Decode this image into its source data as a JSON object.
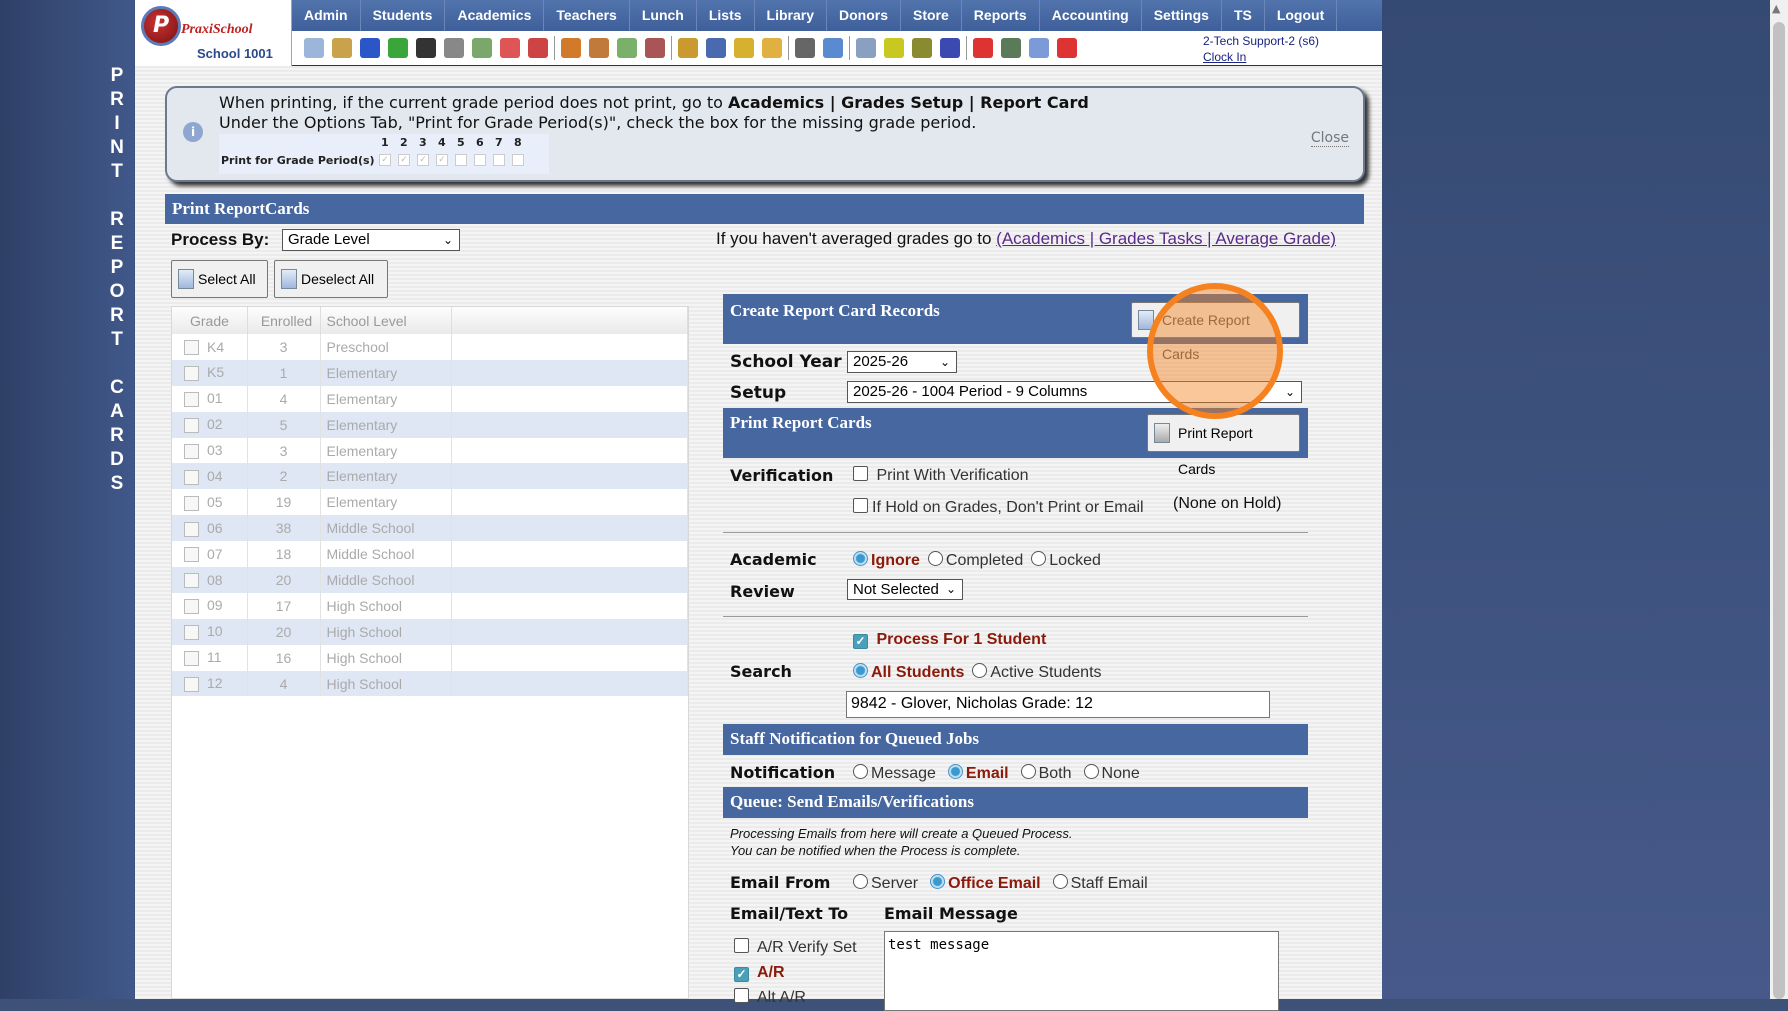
{
  "side_title": [
    "P",
    "R",
    "I",
    "N",
    "T",
    "",
    "R",
    "E",
    "P",
    "O",
    "R",
    "T",
    "",
    "C",
    "A",
    "R",
    "D",
    "S"
  ],
  "logo": {
    "brand": "PraxiSchool",
    "school": "School 1001"
  },
  "nav": [
    "Admin",
    "Students",
    "Academics",
    "Teachers",
    "Lunch",
    "Lists",
    "Library",
    "Donors",
    "Store",
    "Reports",
    "Accounting",
    "Settings",
    "TS",
    "Logout"
  ],
  "toolbar_icons": [
    [
      "search-icon",
      "#9bb6d8"
    ],
    [
      "calendar-grid-icon",
      "#c9a24c"
    ],
    [
      "at-email-icon",
      "#2b56c8"
    ],
    [
      "chat-add-icon",
      "#3aa53a"
    ],
    [
      "mobile-phone-icon",
      "#333"
    ],
    [
      "speaker-icon",
      "#888"
    ],
    [
      "spreadsheet-icon",
      "#7aa86a"
    ],
    [
      "calendar-icon",
      "#d55"
    ],
    [
      "megaphone-icon",
      "#c44"
    ],
    "sep",
    [
      "add-person-icon",
      "#d07a2a"
    ],
    [
      "person-icon",
      "#c07a3a"
    ],
    [
      "money-icon",
      "#7ab06a"
    ],
    [
      "people-icon",
      "#a55"
    ],
    "sep",
    [
      "hamburger-lunch-icon",
      "#c89a30"
    ],
    [
      "book-icon",
      "#4a6ab0"
    ],
    [
      "bell-icon",
      "#d8b030"
    ],
    [
      "export-icon",
      "#e0b040"
    ],
    "sep",
    [
      "staff-icon",
      "#666"
    ],
    [
      "clock-icon",
      "#5a8ad0"
    ],
    "sep",
    [
      "table-icon",
      "#8aa0c0"
    ],
    [
      "card-icon",
      "#c8c820"
    ],
    [
      "printer-icon",
      "#8a8a30"
    ],
    [
      "ap-icon",
      "#3a4ab0"
    ],
    "sep",
    [
      "pdf-icon",
      "#d33"
    ],
    [
      "cash-register-icon",
      "#5a7a5a"
    ],
    [
      "help-icon",
      "#7a9ad8"
    ],
    [
      "power-icon",
      "#d33"
    ]
  ],
  "user": {
    "name": "2-Tech Support-2 (s6)",
    "clock": "Clock In"
  },
  "info": {
    "line1_pre": "When printing, if the current grade period does not print, go to ",
    "line1_bold": "Academics | Grades Setup | Report Card",
    "line2": "Under the Options Tab, \"Print for Grade Period(s)\", check the box for the missing grade period.",
    "period_label": "Print for Grade Period(s)",
    "periods": [
      "1",
      "2",
      "3",
      "4",
      "5",
      "6",
      "7",
      "8"
    ],
    "periods_checked": [
      true,
      true,
      true,
      true,
      false,
      false,
      false,
      false
    ],
    "close": "Close"
  },
  "section_title": "Print ReportCards",
  "process_by": {
    "label": "Process By:",
    "value": "Grade Level"
  },
  "avg_note": {
    "text": "If you haven't averaged grades go to ",
    "link": "(Academics | Grades Tasks | Average Grade)"
  },
  "buttons": {
    "select_all": "Select All",
    "deselect_all": "Deselect All"
  },
  "grid": {
    "headers": [
      "Grade",
      "Enrolled",
      "School Level"
    ],
    "rows": [
      [
        "K4",
        "3",
        "Preschool"
      ],
      [
        "K5",
        "1",
        "Elementary"
      ],
      [
        "01",
        "4",
        "Elementary"
      ],
      [
        "02",
        "5",
        "Elementary"
      ],
      [
        "03",
        "3",
        "Elementary"
      ],
      [
        "04",
        "2",
        "Elementary"
      ],
      [
        "05",
        "19",
        "Elementary"
      ],
      [
        "06",
        "38",
        "Middle School"
      ],
      [
        "07",
        "18",
        "Middle School"
      ],
      [
        "08",
        "20",
        "Middle School"
      ],
      [
        "09",
        "17",
        "High School"
      ],
      [
        "10",
        "20",
        "High School"
      ],
      [
        "11",
        "16",
        "High School"
      ],
      [
        "12",
        "4",
        "High School"
      ]
    ]
  },
  "create": {
    "title": "Create Report Card Records",
    "button": "Create Report Cards"
  },
  "school_year": {
    "label": "School Year",
    "value": "2025-26"
  },
  "setup": {
    "label": "Setup",
    "value": "2025-26 - 1004 Period - 9 Columns"
  },
  "print": {
    "title": "Print Report Cards",
    "button": "Print Report Cards"
  },
  "verification": {
    "label": "Verification",
    "opt1": "Print With Verification",
    "opt1_checked": false,
    "opt2": "If Hold on Grades, Don't Print or Email",
    "opt2_checked": false,
    "hold_note": "(None on Hold)"
  },
  "academic": {
    "label": "Academic",
    "options": [
      "Ignore",
      "Completed",
      "Locked"
    ],
    "selected": "Ignore"
  },
  "review": {
    "label": "Review",
    "value": "Not Selected"
  },
  "process_one": {
    "label": "Process For 1 Student",
    "checked": true
  },
  "search": {
    "label": "Search",
    "options": [
      "All Students",
      "Active Students"
    ],
    "selected": "All Students",
    "value": "9842 - Glover, Nicholas Grade: 12"
  },
  "staff_notif": {
    "title": "Staff Notification for Queued Jobs",
    "label": "Notification",
    "options": [
      "Message",
      "Email",
      "Both",
      "None"
    ],
    "selected": "Email"
  },
  "queue": {
    "title": "Queue: Send Emails/Verifications",
    "note1": "Processing Emails from here will create a Queued Process.",
    "note2": "You can be notified when the Process is complete."
  },
  "email_from": {
    "label": "Email From",
    "options": [
      "Server",
      "Office Email",
      "Staff Email"
    ],
    "selected": "Office Email"
  },
  "email_to": {
    "label": "Email/Text To",
    "items": [
      {
        "label": "A/R Verify Set",
        "checked": false
      },
      {
        "label": "A/R",
        "checked": true
      },
      {
        "label": "Alt A/R",
        "checked": false
      }
    ]
  },
  "email_message": {
    "label": "Email Message",
    "value": "test message"
  },
  "colors": {
    "header_blue": "#4767a0",
    "highlight_orange": "#f5821f",
    "selected_text": "#8b1a0a"
  }
}
